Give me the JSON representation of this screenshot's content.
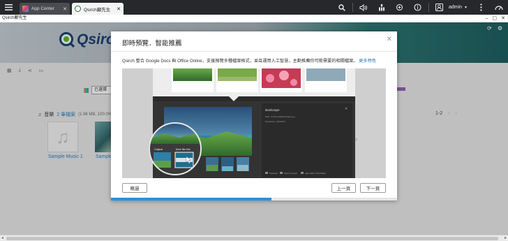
{
  "tabs": [
    {
      "label": "App Center",
      "active": false
    },
    {
      "label": "Qsirch鄺先生",
      "active": true
    }
  ],
  "user": {
    "name": "admin"
  },
  "app": {
    "window_title": "Qsirch鄺先生",
    "logo_text": "Qsirch"
  },
  "background": {
    "filter_label": "已選擇",
    "music_category": "音樂",
    "music_count": "2 筆檔案",
    "music_size": "(1.96 MB, 100.0%)",
    "pager": "1-2",
    "items": [
      {
        "label": "Sample Music 1"
      },
      {
        "label": "Sample"
      }
    ]
  },
  "modal": {
    "title": "即時預覽．智能推薦",
    "description": "Qsirch 整合 Google Docs 與 Office Online，支援預覽多種檔案格式，並且運用人工智慧，主動推薦你可能需要的相關檔案。",
    "more_link": "更多特色",
    "preview": {
      "panel_title": "landscape",
      "path_text": "Path: /multimedia/landscape.jpg",
      "resolution_text": "Resolution: 1000x667",
      "original_label": "Original",
      "more_like_label": "More like this",
      "footer_actions": [
        "Download",
        "Open in browser",
        "Open folder in File Station"
      ]
    },
    "buttons": {
      "skip": "略過",
      "prev": "上一頁",
      "next": "下一頁"
    },
    "progress": 0.56
  },
  "colors": {
    "accent": "#2f8fd8",
    "link": "#2a7ab8",
    "topbar": "#26282c"
  }
}
